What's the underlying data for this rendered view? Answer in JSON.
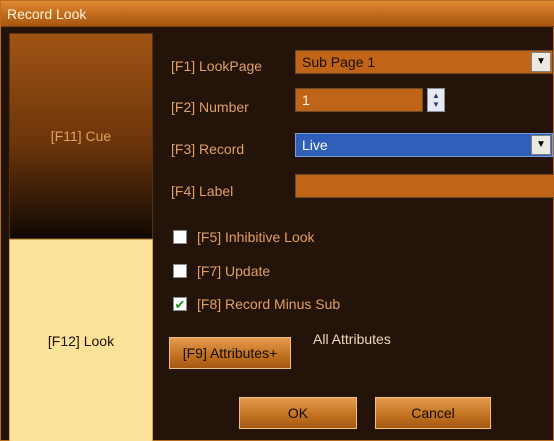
{
  "window": {
    "title": "Record Look"
  },
  "sidebar": {
    "cue_label": "[F11] Cue",
    "look_label": "[F12] Look"
  },
  "form": {
    "lookpage": {
      "label": "[F1] LookPage",
      "value": "Sub Page 1"
    },
    "number": {
      "label": "[F2] Number",
      "value": "1"
    },
    "record": {
      "label": "[F3] Record",
      "value": "Live"
    },
    "label_field": {
      "label": "[F4] Label",
      "value": ""
    }
  },
  "options": {
    "inhibitive": {
      "label": "[F5] Inhibitive Look",
      "checked": false
    },
    "update": {
      "label": "[F7] Update",
      "checked": false
    },
    "record_minus_sub": {
      "label": "[F8] Record Minus Sub",
      "checked": true
    }
  },
  "attributes": {
    "button_label": "[F9] Attributes+",
    "summary": "All Attributes"
  },
  "actions": {
    "ok_label": "OK",
    "cancel_label": "Cancel"
  },
  "icons": {
    "dropdown": "chevron-down-icon",
    "spin_up": "chevron-up-icon",
    "spin_down": "chevron-down-icon",
    "check": "checkmark-icon"
  },
  "colors": {
    "titlebar": "#c87828",
    "background": "#241308",
    "field": "#c06418",
    "selection": "#2f5fb8",
    "look_panel": "#fde39a",
    "label_text": "#e0a066"
  }
}
